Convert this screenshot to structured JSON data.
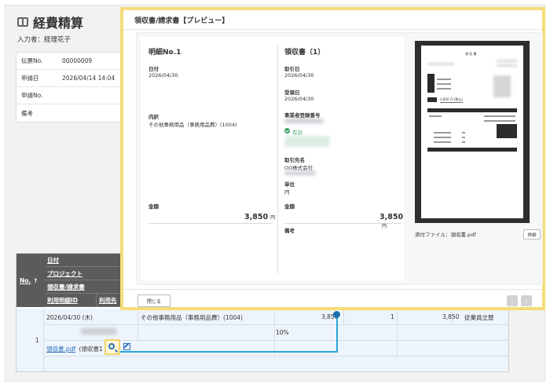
{
  "page": {
    "title": "経費精算",
    "inputter": "入力者：経理花子"
  },
  "info": [
    {
      "key": "伝票No.",
      "value": "00000009"
    },
    {
      "key": "申請日",
      "value": "2026/04/14 14:04"
    },
    {
      "key": "申請No.",
      "value": ""
    },
    {
      "key": "備考",
      "value": ""
    }
  ],
  "table": {
    "headers": {
      "no": "No.",
      "sort_arrow": "↑",
      "date": "日付",
      "project": "プロジェクト",
      "receipt": "領収書/請求書",
      "usage_id": "利用明細ID",
      "usage_dest": "利用先"
    },
    "row": {
      "num": "1",
      "date": "2026/04/30 (木)",
      "item": "その他事務用品（事務用品費）(1004)",
      "amount_partial": "3,850",
      "qty": "1",
      "total": "3,850",
      "payment": "従業員立替",
      "rate": "10%",
      "file_link": "領収書.pdf",
      "file_note": "(領収書1"
    }
  },
  "modal": {
    "title": "領収書/請求書【プレビュー】",
    "left": {
      "heading": "明細No.1",
      "date_label": "日付",
      "date_value": "2026/04/30",
      "item_label": "内訳",
      "item_value": "その他事務用品（事務用品費）(1004)",
      "amount_label": "金額",
      "amount_value": "3,850",
      "amount_unit": "円"
    },
    "right": {
      "heading": "領収書（1）",
      "trade_date_label": "取引日",
      "trade_date_value": "2026/04/30",
      "received_label": "受領日",
      "received_value": "2026/04/30",
      "reg_no_label": "事業者登録番号",
      "valid_text": "有効",
      "partner_label": "取引先名",
      "partner_value": "OO株式会社",
      "unit_label": "単位",
      "unit_value": "円",
      "amount_label": "金額",
      "amount_value": "3,850",
      "amount_unit": "円",
      "note_label": "備考"
    },
    "attachment": "添付ファイル：領収書.pdf",
    "detail_button": "詳細",
    "close_button": "閉じる",
    "preview_doc_title": "領 収 書",
    "preview_amount": "3,850 円 (税込)",
    "prev": "‹",
    "next": "›"
  }
}
